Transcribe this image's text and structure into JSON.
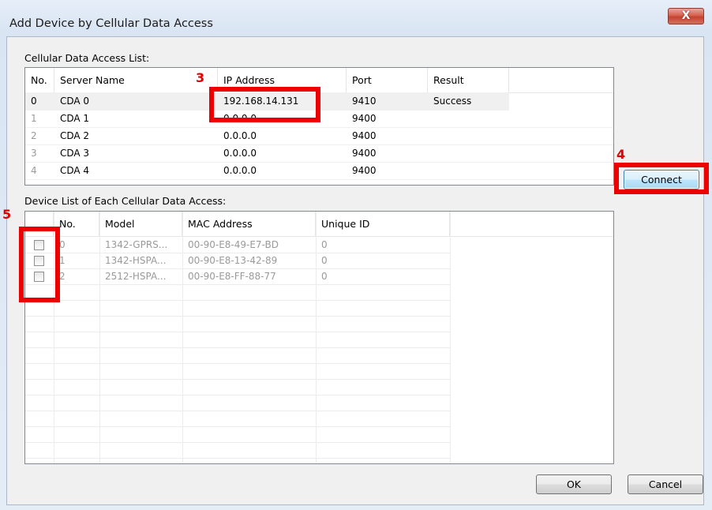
{
  "window": {
    "title": "Add Device by Cellular Data Access",
    "close_glyph": "X"
  },
  "cda_section": {
    "label": "Cellular Data Access List:",
    "columns": [
      "No.",
      "Server Name",
      "IP Address",
      "Port",
      "Result"
    ],
    "rows": [
      {
        "no": "0",
        "name": "CDA 0",
        "ip": "192.168.14.131",
        "port": "9410",
        "result": "Success"
      },
      {
        "no": "1",
        "name": "CDA 1",
        "ip": "0.0.0.0",
        "port": "9400",
        "result": ""
      },
      {
        "no": "2",
        "name": "CDA 2",
        "ip": "0.0.0.0",
        "port": "9400",
        "result": ""
      },
      {
        "no": "3",
        "name": "CDA 3",
        "ip": "0.0.0.0",
        "port": "9400",
        "result": ""
      },
      {
        "no": "4",
        "name": "CDA 4",
        "ip": "0.0.0.0",
        "port": "9400",
        "result": ""
      }
    ]
  },
  "device_section": {
    "label": "Device List of Each Cellular Data Access:",
    "columns": [
      "",
      "No.",
      "Model",
      "MAC Address",
      "Unique ID"
    ],
    "rows": [
      {
        "no": "0",
        "model": "1342-GPRS...",
        "mac": "00-90-E8-49-E7-BD",
        "uid": "0",
        "checked": false
      },
      {
        "no": "1",
        "model": "1342-HSPA...",
        "mac": "00-90-E8-13-42-89",
        "uid": "0",
        "checked": false
      },
      {
        "no": "2",
        "model": "2512-HSPA...",
        "mac": "00-90-E8-FF-88-77",
        "uid": "0",
        "checked": false
      }
    ]
  },
  "buttons": {
    "connect": "Connect",
    "ok": "OK",
    "cancel": "Cancel"
  },
  "callouts": {
    "ip": "3",
    "connect": "4",
    "checkboxes": "5"
  },
  "colors": {
    "callout": "#ee0000",
    "focus_button": "#a7d9f5"
  }
}
